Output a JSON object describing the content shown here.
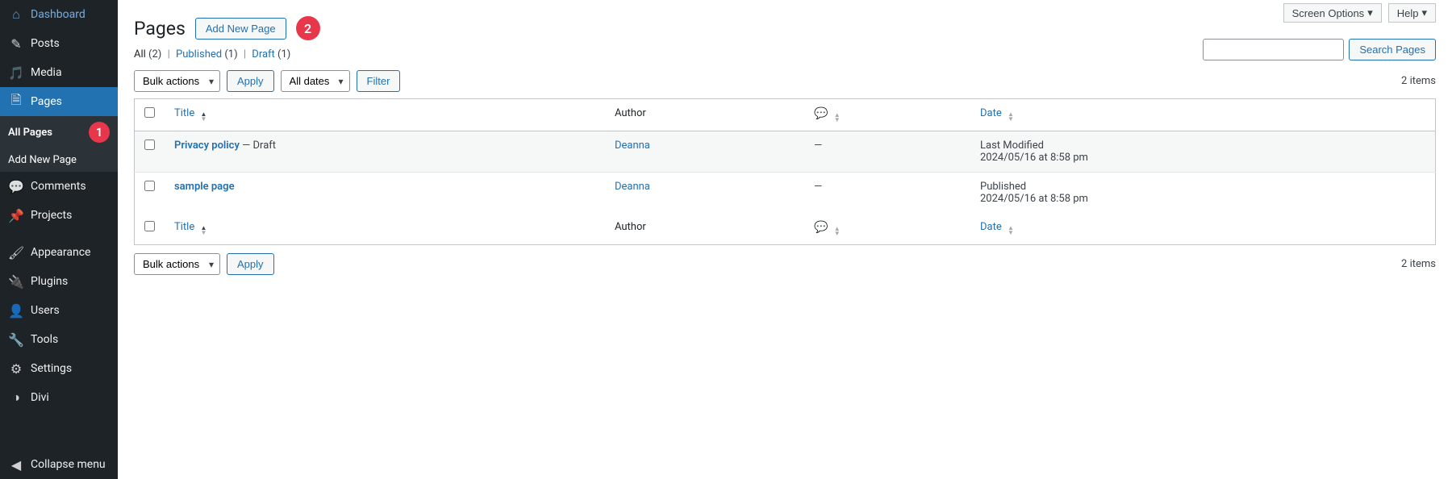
{
  "sidebar": {
    "items": [
      {
        "label": "Dashboard",
        "icon": "⌂"
      },
      {
        "label": "Posts",
        "icon": "✎"
      },
      {
        "label": "Media",
        "icon": "🎵"
      },
      {
        "label": "Pages",
        "icon": "🗎"
      },
      {
        "label": "Comments",
        "icon": "💬"
      },
      {
        "label": "Projects",
        "icon": "📌"
      },
      {
        "label": "Appearance",
        "icon": "🖌"
      },
      {
        "label": "Plugins",
        "icon": "🔌"
      },
      {
        "label": "Users",
        "icon": "👤"
      },
      {
        "label": "Tools",
        "icon": "🔧"
      },
      {
        "label": "Settings",
        "icon": "⚙"
      },
      {
        "label": "Divi",
        "icon": "◑"
      }
    ],
    "submenu": {
      "all_pages": "All Pages",
      "add_new": "Add New Page"
    },
    "collapse": "Collapse menu"
  },
  "annotations": {
    "badge1": "1",
    "badge2": "2"
  },
  "topright": {
    "screen_options": "Screen Options",
    "help": "Help"
  },
  "header": {
    "title": "Pages",
    "add_new": "Add New Page"
  },
  "filters": {
    "all_label": "All",
    "all_count": "(2)",
    "published_label": "Published",
    "published_count": "(1)",
    "draft_label": "Draft",
    "draft_count": "(1)"
  },
  "search": {
    "button": "Search Pages"
  },
  "bulkactions": {
    "label": "Bulk actions",
    "apply": "Apply"
  },
  "datefilter": {
    "all_dates": "All dates",
    "filter": "Filter"
  },
  "counts": {
    "items": "2 items"
  },
  "table": {
    "cols": {
      "title": "Title",
      "author": "Author",
      "date": "Date"
    },
    "rows": [
      {
        "title": "Privacy policy",
        "status": " — Draft",
        "author": "Deanna",
        "comments": "—",
        "date_status": "Last Modified",
        "date_value": "2024/05/16 at 8:58 pm"
      },
      {
        "title": "sample page",
        "status": "",
        "author": "Deanna",
        "comments": "—",
        "date_status": "Published",
        "date_value": "2024/05/16 at 8:58 pm"
      }
    ]
  }
}
